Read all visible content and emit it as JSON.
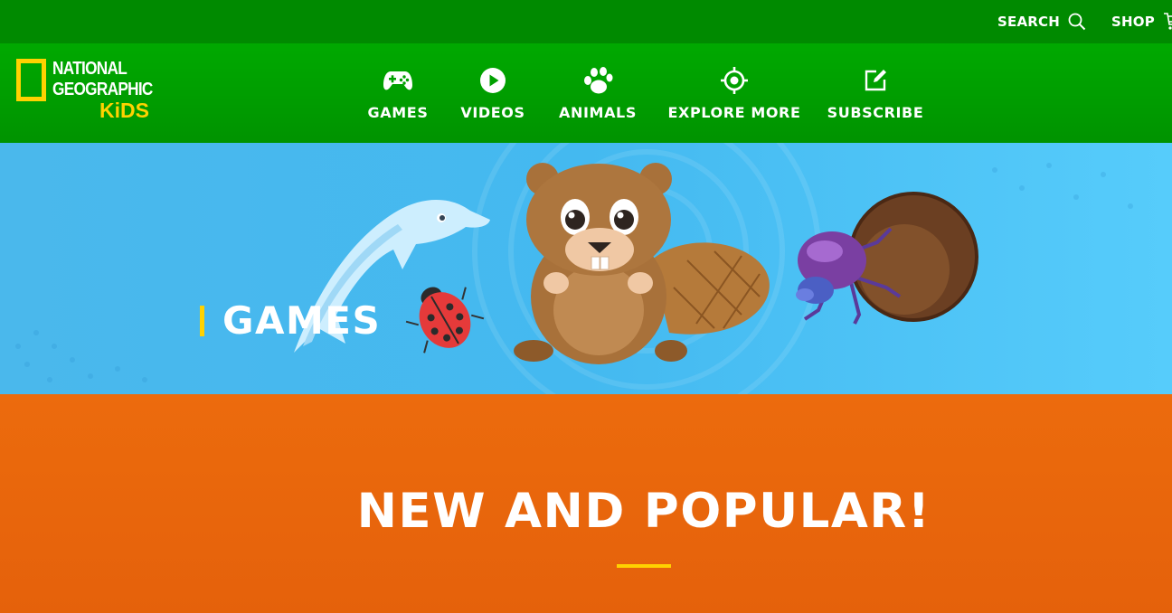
{
  "topbar": {
    "search_label": "SEARCH",
    "search_icon": "search-icon",
    "shop_label": "SHOP",
    "shop_icon": "cart-icon"
  },
  "logo": {
    "line1": "NATIONAL",
    "line2": "GEOGRAPHIC",
    "line3": "KiDS"
  },
  "nav": {
    "items": [
      {
        "label": "GAMES",
        "icon": "gamepad-icon"
      },
      {
        "label": "VIDEOS",
        "icon": "play-icon"
      },
      {
        "label": "ANIMALS",
        "icon": "paw-icon"
      },
      {
        "label": "EXPLORE MORE",
        "icon": "target-icon"
      },
      {
        "label": "SUBSCRIBE",
        "icon": "edit-icon"
      }
    ]
  },
  "hero": {
    "title": "GAMES",
    "illustrations": [
      "dolphin",
      "ladybug",
      "beaver",
      "dung-beetle"
    ]
  },
  "section": {
    "title": "NEW AND POPULAR!"
  },
  "colors": {
    "topbar": "#008a00",
    "navbar": "#00a000",
    "accent_yellow": "#ffd200",
    "hero_blue": "#4ab8ec",
    "section_orange": "#e8650c"
  }
}
